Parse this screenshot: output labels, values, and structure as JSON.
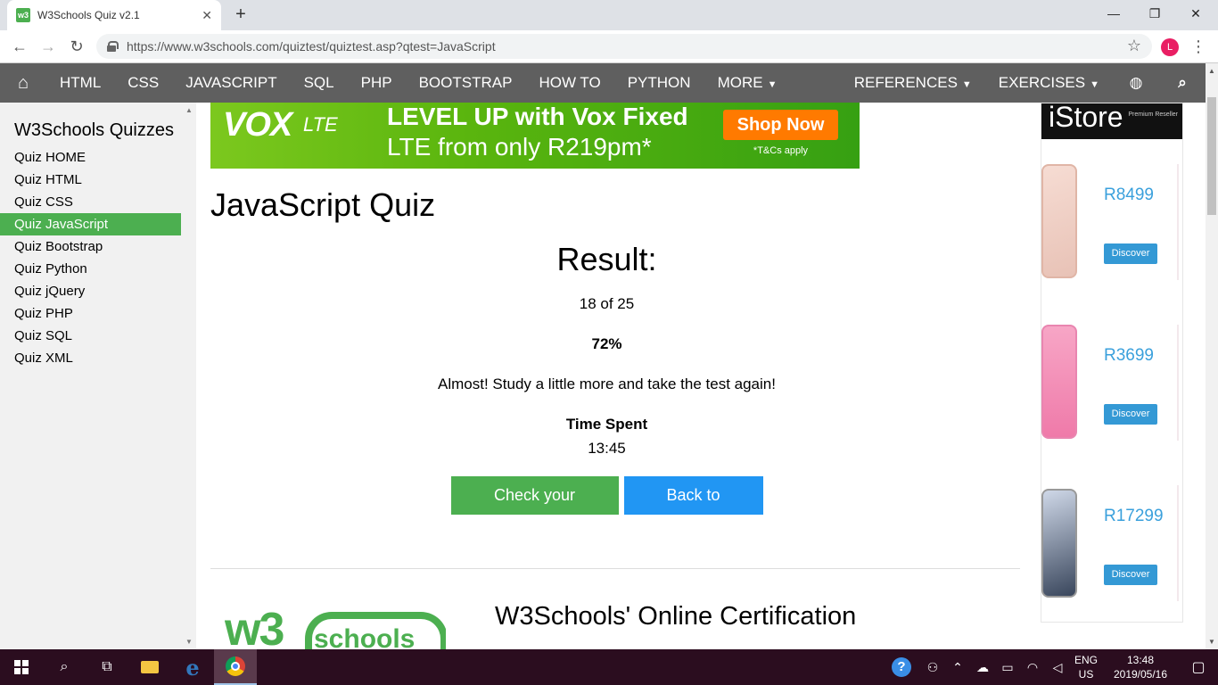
{
  "browser": {
    "tab_title": "W3Schools Quiz v2.1",
    "tab_favicon": "w3",
    "tab_close": "✕",
    "new_tab": "+",
    "url": "https://www.w3schools.com/quiztest/quiztest.asp?qtest=JavaScript",
    "profile_initial": "L",
    "window_controls": {
      "minimize": "—",
      "restore": "❐",
      "close": "✕"
    }
  },
  "nav": {
    "items": [
      "HTML",
      "CSS",
      "JAVASCRIPT",
      "SQL",
      "PHP",
      "BOOTSTRAP",
      "HOW TO",
      "PYTHON",
      "MORE"
    ],
    "right_items": [
      "REFERENCES",
      "EXERCISES"
    ]
  },
  "sidebar": {
    "heading": "W3Schools Quizzes",
    "links": [
      "Quiz HOME",
      "Quiz HTML",
      "Quiz CSS",
      "Quiz JavaScript",
      "Quiz Bootstrap",
      "Quiz Python",
      "Quiz jQuery",
      "Quiz PHP",
      "Quiz SQL",
      "Quiz XML"
    ],
    "active_index": 3
  },
  "banner": {
    "logo": "VOX",
    "lte": "LTE",
    "line1": "LEVEL UP with Vox Fixed",
    "line2": "LTE from only R219pm*",
    "cta": "Shop Now",
    "fineprint": "*T&Cs apply"
  },
  "main": {
    "title": "JavaScript Quiz",
    "result_heading": "Result:",
    "score": "18 of 25",
    "percent": "72%",
    "message": "Almost! Study a little more and take the test again!",
    "time_label": "Time Spent",
    "time_value": "13:45",
    "check_button": "Check your answers",
    "back_button": "Back to Quizzes",
    "cert_title": "W3Schools' Online Certification",
    "logo_w3": "w3",
    "logo_schools": "schools"
  },
  "right_ad": {
    "brand": "iStore",
    "badge": "Premium Reseller",
    "products": [
      {
        "price": "R8499",
        "button": "Discover"
      },
      {
        "price": "R3699",
        "button": "Discover"
      },
      {
        "price": "R17299",
        "button": "Discover"
      }
    ]
  },
  "taskbar": {
    "lang_top": "ENG",
    "lang_bottom": "US",
    "time": "13:48",
    "date": "2019/05/16"
  },
  "colors": {
    "nav_bg": "#5f5f5f",
    "w3_green": "#4caf50",
    "blue_button": "#2196f3",
    "taskbar_bg": "#2b0d1f"
  }
}
